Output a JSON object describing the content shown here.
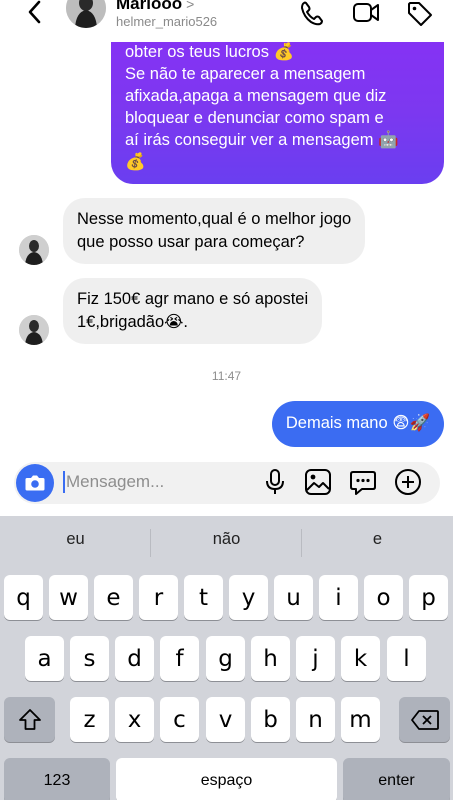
{
  "header": {
    "contact_name": "Mariooo",
    "chevron": ">",
    "username": "helmer_mario526",
    "icons": [
      "back-icon",
      "phone-icon",
      "video-icon",
      "tag-icon"
    ]
  },
  "messages": {
    "outgoing_purple": [
      "obter os teus lucros 💰",
      "Se não te aparecer a mensagem",
      "afixada,apaga a mensagem que diz",
      "bloquear e denunciar como spam e",
      "aí irás conseguir ver a mensagem 🤖",
      "💰"
    ],
    "incoming_1": [
      "Nesse momento,qual é o melhor jogo",
      "que posso usar para começar?"
    ],
    "incoming_2": [
      "Fiz 150€ agr mano e só apostei",
      "1€,brigadão😭."
    ],
    "timestamp": "11:47",
    "outgoing_blue": "Demais mano 😨🚀"
  },
  "composer": {
    "placeholder": "Mensagem...",
    "icons": [
      "camera-icon",
      "microphone-icon",
      "gallery-icon",
      "sticker-icon",
      "add-icon"
    ]
  },
  "keyboard": {
    "suggestions": [
      "eu",
      "não",
      "e"
    ],
    "row1": [
      "q",
      "w",
      "e",
      "r",
      "t",
      "y",
      "u",
      "i",
      "o",
      "p"
    ],
    "row2": [
      "a",
      "s",
      "d",
      "f",
      "g",
      "h",
      "j",
      "k",
      "l"
    ],
    "row3": [
      "z",
      "x",
      "c",
      "v",
      "b",
      "n",
      "m"
    ],
    "numbers_label": "123",
    "space_label": "espaço",
    "enter_label": "enter"
  },
  "colors": {
    "accent_blue": "#3b6cf2",
    "bubble_purple": "#7c38f0",
    "incoming_gray": "#efefef",
    "keyboard_bg": "#d2d4da"
  }
}
